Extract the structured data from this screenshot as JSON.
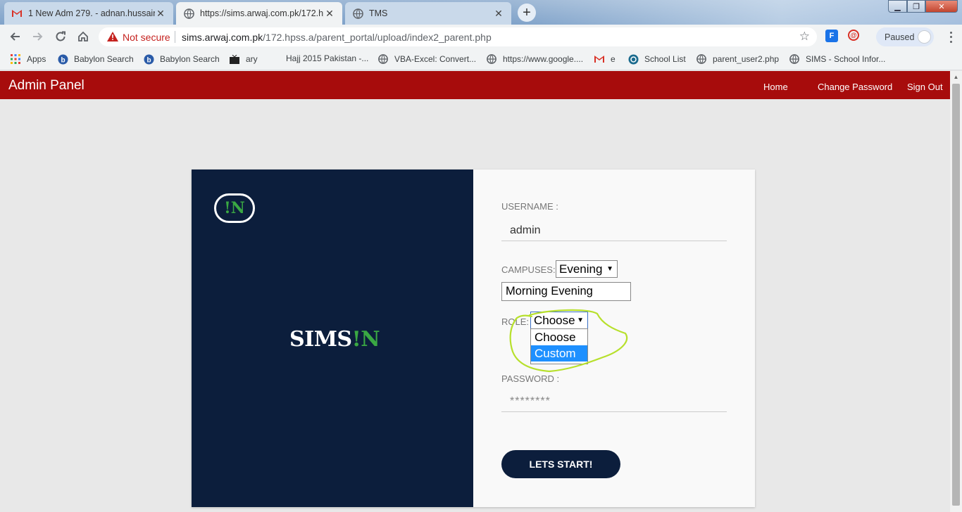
{
  "browser": {
    "tabs": [
      {
        "title": "1 New Adm 279. - adnan.hussain",
        "icon": "gmail-icon"
      },
      {
        "title": "https://sims.arwaj.com.pk/172.hp",
        "icon": "globe-icon"
      },
      {
        "title": "TMS",
        "icon": "globe-icon"
      }
    ],
    "security_label": "Not secure",
    "url_host": "sims.arwaj.com.pk",
    "url_path": "/172.hpss.a/parent_portal/upload/index2_parent.php",
    "profile_status": "Paused",
    "bookmarks": [
      "Apps",
      "Babylon Search",
      "Babylon Search",
      "ary",
      "Hajj 2015 Pakistan -...",
      "VBA-Excel: Convert...",
      "https://www.google....",
      "e",
      "School List",
      "parent_user2.php",
      "SIMS - School Infor..."
    ]
  },
  "header": {
    "brand": "Admin Panel",
    "nav": [
      "Home",
      "Change Password",
      "Sign Out"
    ],
    "color": "#a70c0c"
  },
  "logo": {
    "prefix": "SIMS",
    "bang": "!",
    "suffix": "N",
    "accent": "#3aa843",
    "panel_color": "#0c1e3c"
  },
  "form": {
    "username_label": "USERNAME :",
    "username_value": "admin",
    "campuses_label": "CAMPUSES:",
    "campus_selected": "Evening",
    "campus_text": "Morning Evening",
    "role_label": "ROLE:",
    "role_selected": "Choose",
    "role_options": [
      "Choose",
      "Custom"
    ],
    "role_highlighted": "Custom",
    "password_label": "PASSWORD :",
    "password_value": "********",
    "submit_label": "LETS START!"
  }
}
